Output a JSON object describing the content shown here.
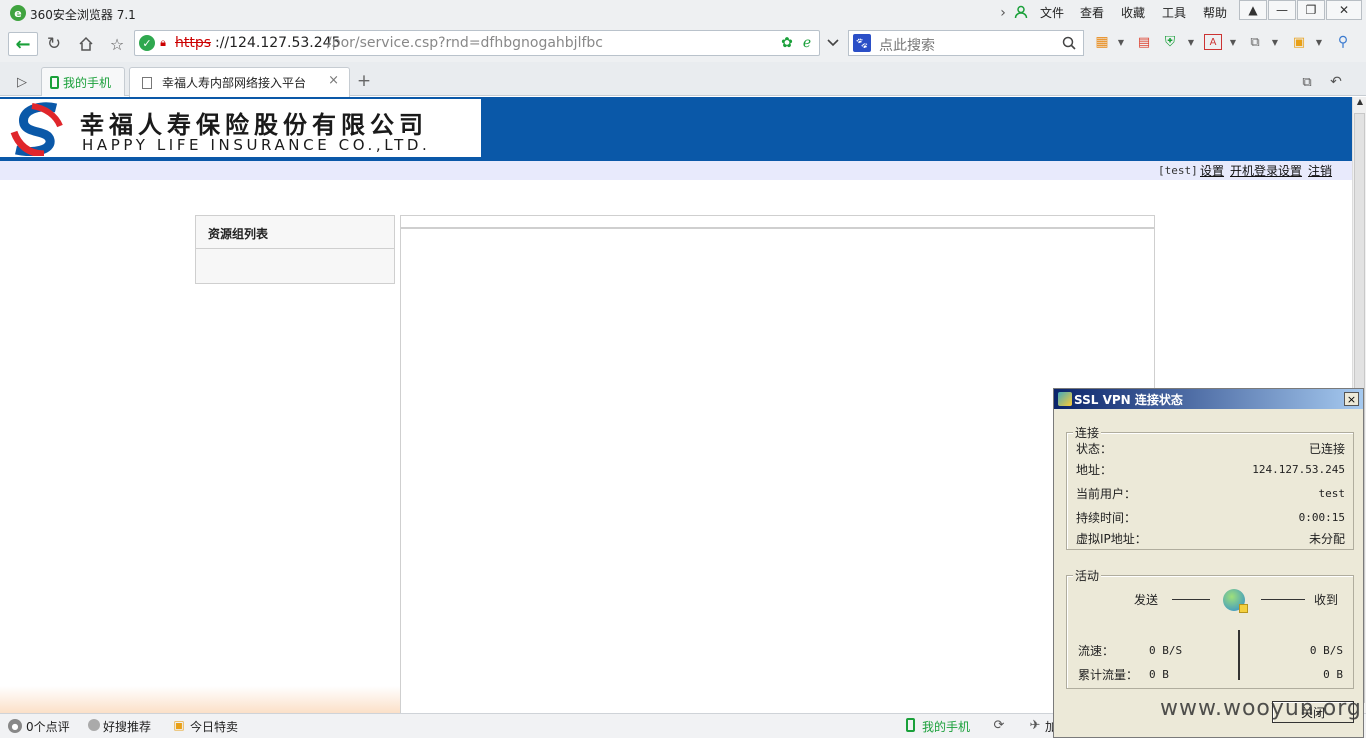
{
  "browser": {
    "title": "360安全浏览器 7.1",
    "menu": [
      "文件",
      "查看",
      "收藏",
      "工具",
      "帮助"
    ],
    "url_scheme": "https",
    "url_host": "://124.127.53.245",
    "url_path": "/por/service.csp?rnd=dfhbgnogahbjlfbc",
    "search_placeholder": "点此搜索",
    "tabs": [
      {
        "label": "我的手机"
      },
      {
        "label": "幸福人寿内部网络接入平台",
        "close": "×"
      }
    ],
    "new_tab": "+"
  },
  "page": {
    "company_cn": "幸福人寿保险股份有限公司",
    "company_en": "HAPPY LIFE INSURANCE CO.,LTD.",
    "user_tag": "[test]",
    "links": [
      "设置",
      "开机登录设置",
      "注销"
    ],
    "sidebar_title": "资源组列表"
  },
  "vpn": {
    "title": "SSL VPN 连接状态",
    "close": "×",
    "conn_legend": "连接",
    "rows": [
      {
        "label": "状态：",
        "value": "已连接"
      },
      {
        "label": "地址：",
        "value": "124.127.53.245"
      },
      {
        "label": "当前用户：",
        "value": "test"
      },
      {
        "label": "持续时间：",
        "value": "0:00:15"
      },
      {
        "label": "虚拟IP地址：",
        "value": "未分配"
      }
    ],
    "activity_legend": "活动",
    "send": "发送",
    "recv": "收到",
    "speed_label": "流速：",
    "speed_send": "0 B/S",
    "speed_recv": "0 B/S",
    "total_label": "累计流量：",
    "total_send": "0 B",
    "total_recv": "0 B",
    "close_btn": "关闭"
  },
  "statusbar": {
    "comments": "0个点评",
    "recommend": "好搜推荐",
    "deals": "今日特卖",
    "phone": "我的手机",
    "more": "加"
  },
  "watermark": "www.wooyun.org",
  "colors": {
    "banner": "#0a58a8",
    "logo_red": "#e0262b",
    "logo_blue": "#0a58a8",
    "green": "#1aa03a"
  }
}
